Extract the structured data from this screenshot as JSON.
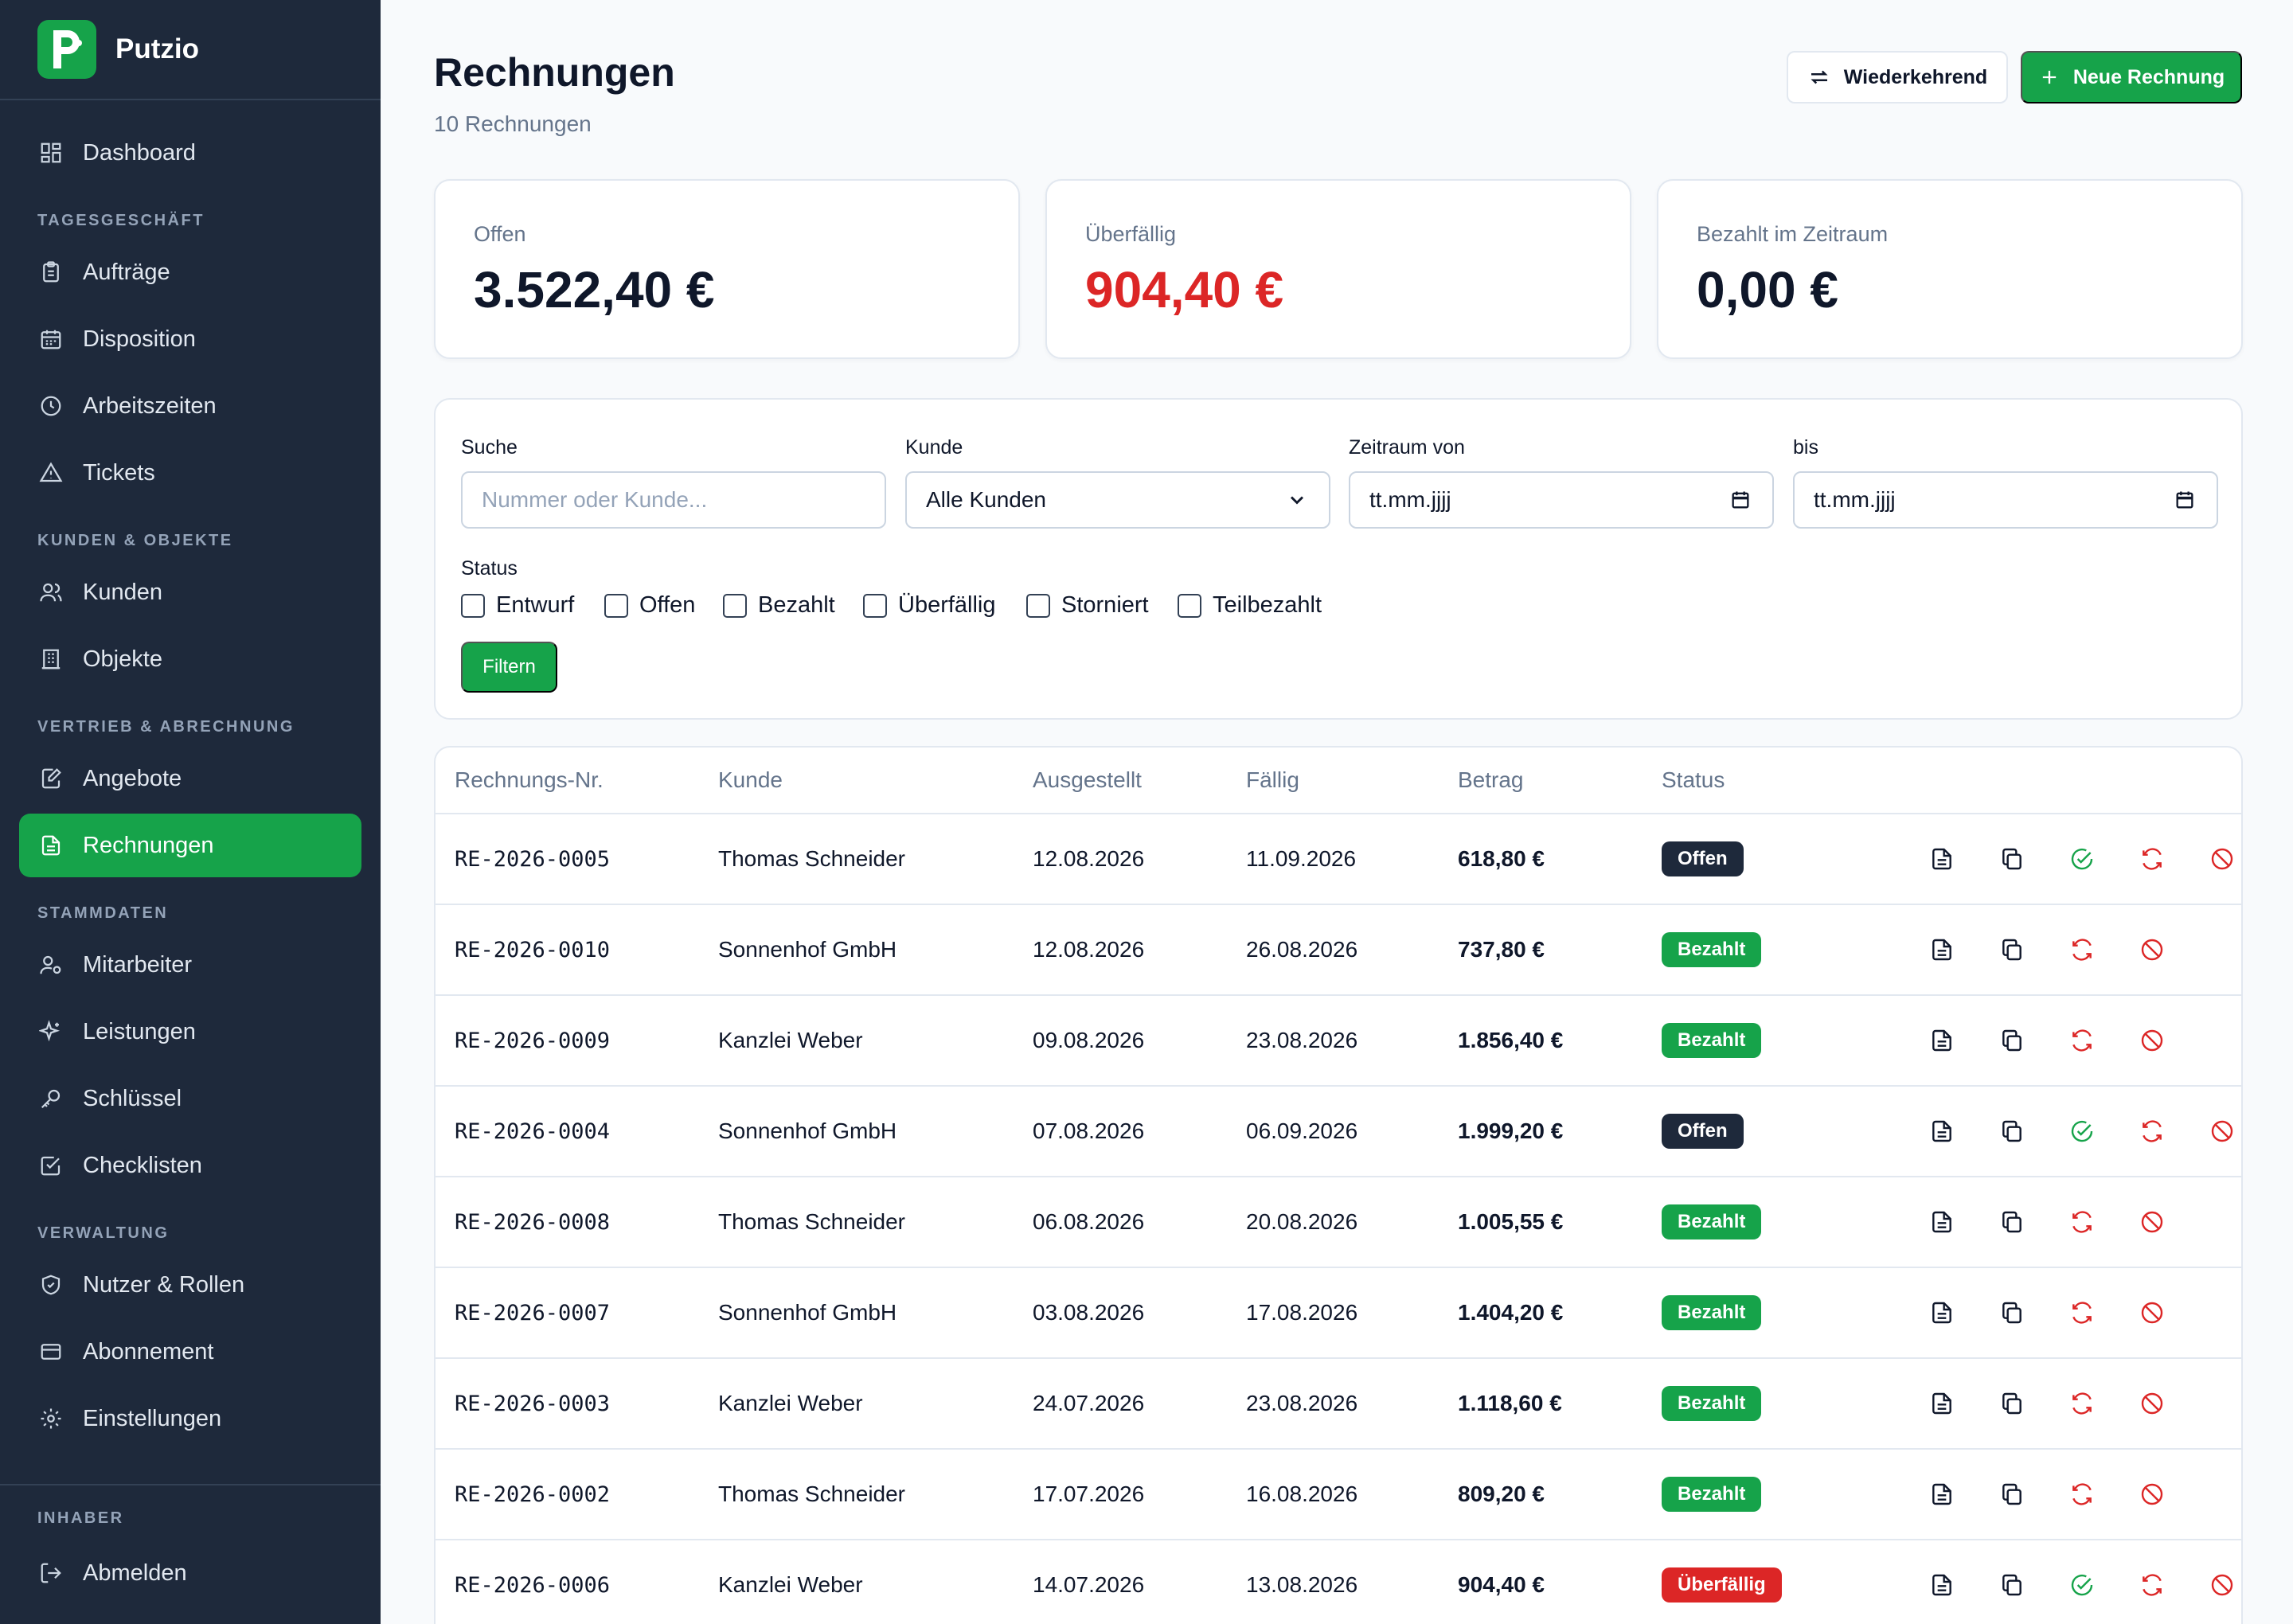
{
  "app": {
    "name": "Putzio",
    "logo_letter": "P"
  },
  "sidebar": {
    "dashboard": "Dashboard",
    "sections": [
      "TAGESGESCHÄFT",
      "KUNDEN & OBJEKTE",
      "VERTRIEB & ABRECHNUNG",
      "STAMMDATEN",
      "VERWALTUNG",
      "INHABER"
    ],
    "items": [
      {
        "label": "Aufträge",
        "icon": "clipboard-icon"
      },
      {
        "label": "Disposition",
        "icon": "calendar-icon"
      },
      {
        "label": "Arbeitszeiten",
        "icon": "clock-icon"
      },
      {
        "label": "Tickets",
        "icon": "warning-icon"
      },
      {
        "label": "Kunden",
        "icon": "users-icon"
      },
      {
        "label": "Objekte",
        "icon": "building-icon"
      },
      {
        "label": "Angebote",
        "icon": "edit-document-icon"
      },
      {
        "label": "Rechnungen",
        "icon": "document-icon"
      },
      {
        "label": "Mitarbeiter",
        "icon": "user-cog-icon"
      },
      {
        "label": "Leistungen",
        "icon": "sparkles-icon"
      },
      {
        "label": "Schlüssel",
        "icon": "key-icon"
      },
      {
        "label": "Checklisten",
        "icon": "checkbox-icon"
      },
      {
        "label": "Nutzer & Rollen",
        "icon": "shield-icon"
      },
      {
        "label": "Abonnement",
        "icon": "credit-card-icon"
      },
      {
        "label": "Einstellungen",
        "icon": "gear-icon"
      }
    ],
    "logout": "Abmelden"
  },
  "header": {
    "title": "Rechnungen",
    "subtitle": "10 Rechnungen",
    "recurring_label": "Wiederkehrend",
    "new_label": "Neue Rechnung"
  },
  "stats": [
    {
      "label": "Offen",
      "value": "3.522,40 €"
    },
    {
      "label": "Überfällig",
      "value": "904,40 €"
    },
    {
      "label": "Bezahlt im Zeitraum",
      "value": "0,00 €"
    }
  ],
  "filter": {
    "search_label": "Suche",
    "search_placeholder": "Nummer oder Kunde...",
    "customer_label": "Kunde",
    "customer_value": "Alle Kunden",
    "from_label": "Zeitraum von",
    "from_value": "tt.mm.jjjj",
    "to_label": "bis",
    "to_value": "tt.mm.jjjj",
    "status_label": "Status",
    "statuses": [
      "Entwurf",
      "Offen",
      "Bezahlt",
      "Überfällig",
      "Storniert",
      "Teilbezahlt"
    ],
    "submit_label": "Filtern"
  },
  "table": {
    "columns": [
      "Rechnungs-Nr.",
      "Kunde",
      "Ausgestellt",
      "Fällig",
      "Betrag",
      "Status"
    ],
    "rows": [
      {
        "nr": "RE-2026-0005",
        "kunde": "Thomas Schneider",
        "ausgestellt": "12.08.2026",
        "faellig": "11.09.2026",
        "betrag": "618,80 €",
        "status": "Offen"
      },
      {
        "nr": "RE-2026-0010",
        "kunde": "Sonnenhof GmbH",
        "ausgestellt": "12.08.2026",
        "faellig": "26.08.2026",
        "betrag": "737,80 €",
        "status": "Bezahlt"
      },
      {
        "nr": "RE-2026-0009",
        "kunde": "Kanzlei Weber",
        "ausgestellt": "09.08.2026",
        "faellig": "23.08.2026",
        "betrag": "1.856,40 €",
        "status": "Bezahlt"
      },
      {
        "nr": "RE-2026-0004",
        "kunde": "Sonnenhof GmbH",
        "ausgestellt": "07.08.2026",
        "faellig": "06.09.2026",
        "betrag": "1.999,20 €",
        "status": "Offen"
      },
      {
        "nr": "RE-2026-0008",
        "kunde": "Thomas Schneider",
        "ausgestellt": "06.08.2026",
        "faellig": "20.08.2026",
        "betrag": "1.005,55 €",
        "status": "Bezahlt"
      },
      {
        "nr": "RE-2026-0007",
        "kunde": "Sonnenhof GmbH",
        "ausgestellt": "03.08.2026",
        "faellig": "17.08.2026",
        "betrag": "1.404,20 €",
        "status": "Bezahlt"
      },
      {
        "nr": "RE-2026-0003",
        "kunde": "Kanzlei Weber",
        "ausgestellt": "24.07.2026",
        "faellig": "23.08.2026",
        "betrag": "1.118,60 €",
        "status": "Bezahlt"
      },
      {
        "nr": "RE-2026-0002",
        "kunde": "Thomas Schneider",
        "ausgestellt": "17.07.2026",
        "faellig": "16.08.2026",
        "betrag": "809,20 €",
        "status": "Bezahlt"
      },
      {
        "nr": "RE-2026-0006",
        "kunde": "Kanzlei Weber",
        "ausgestellt": "14.07.2026",
        "faellig": "13.08.2026",
        "betrag": "904,40 €",
        "status": "Überfällig"
      }
    ]
  },
  "colors": {
    "brand": "#16a34a",
    "sidebar": "#1e293b",
    "danger": "#dc2626",
    "text": "#0f172a",
    "muted": "#64748b"
  }
}
